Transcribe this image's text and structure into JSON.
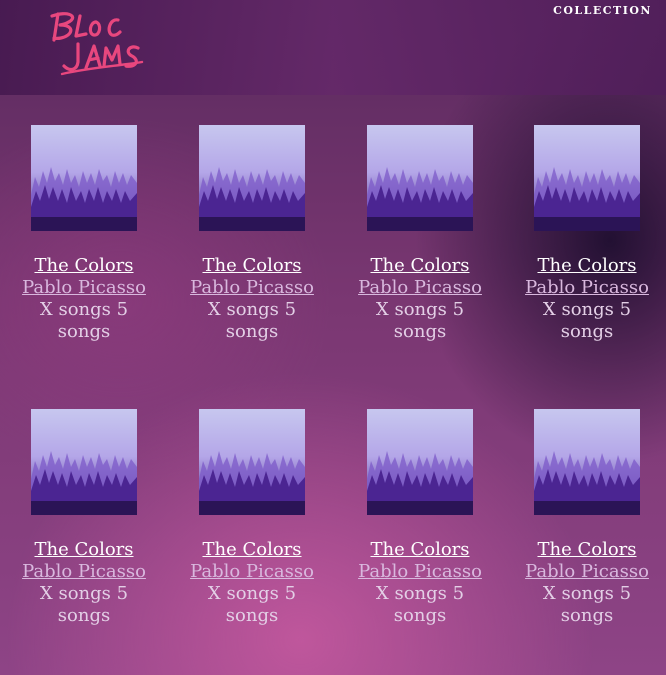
{
  "header": {
    "logo_text": "Bloc Jams",
    "nav_collection": "COLLECTION"
  },
  "colors": {
    "logo_pink": "#e8477e",
    "title_white": "#ffffff",
    "artist_lilac": "#d9b8de"
  },
  "albums": [
    {
      "title": "The Colors",
      "artist": "Pablo Picasso",
      "song_count": "X songs 5 songs",
      "cover_icon": "misty-forest-cover"
    },
    {
      "title": "The Colors",
      "artist": "Pablo Picasso",
      "song_count": "X songs 5 songs",
      "cover_icon": "misty-forest-cover"
    },
    {
      "title": "The Colors",
      "artist": "Pablo Picasso",
      "song_count": "X songs 5 songs",
      "cover_icon": "misty-forest-cover"
    },
    {
      "title": "The Colors",
      "artist": "Pablo Picasso",
      "song_count": "X songs 5 songs",
      "cover_icon": "misty-forest-cover"
    },
    {
      "title": "The Colors",
      "artist": "Pablo Picasso",
      "song_count": "X songs 5 songs",
      "cover_icon": "misty-forest-cover"
    },
    {
      "title": "The Colors",
      "artist": "Pablo Picasso",
      "song_count": "X songs 5 songs",
      "cover_icon": "misty-forest-cover"
    },
    {
      "title": "The Colors",
      "artist": "Pablo Picasso",
      "song_count": "X songs 5 songs",
      "cover_icon": "misty-forest-cover"
    },
    {
      "title": "The Colors",
      "artist": "Pablo Picasso",
      "song_count": "X songs 5 songs",
      "cover_icon": "misty-forest-cover"
    }
  ]
}
